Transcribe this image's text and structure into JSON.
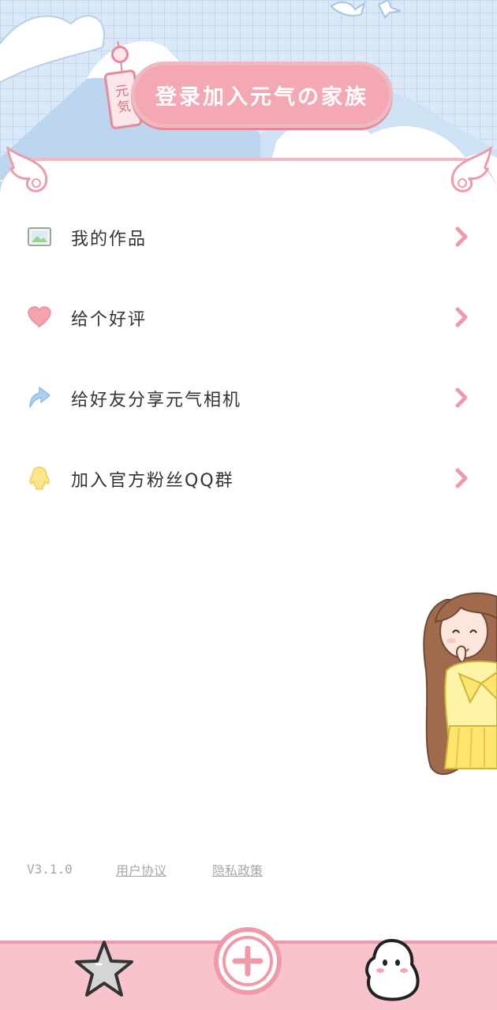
{
  "header": {
    "tag_chars": [
      "元",
      "気"
    ],
    "login_label": "登录加入元气の家族"
  },
  "menu": {
    "items": [
      {
        "label": "我的作品",
        "icon": "picture-icon"
      },
      {
        "label": "给个好评",
        "icon": "heart-icon"
      },
      {
        "label": "给好友分享元气相机",
        "icon": "share-arrow-icon"
      },
      {
        "label": "加入官方粉丝QQ群",
        "icon": "qq-penguin-icon"
      }
    ]
  },
  "footer": {
    "version": "V3.1.0",
    "agreement_label": "用户协议",
    "privacy_label": "隐私政策"
  },
  "tabbar": {
    "items": [
      "star-icon",
      "plus-icon",
      "ghost-mascot-icon"
    ]
  },
  "colors": {
    "accent_pink": "#f3a8b3",
    "border_pink": "#ee9aa9",
    "sky_blue": "#dbe9f7",
    "text_dark": "#333333",
    "muted_gray": "#a7a7a7"
  }
}
